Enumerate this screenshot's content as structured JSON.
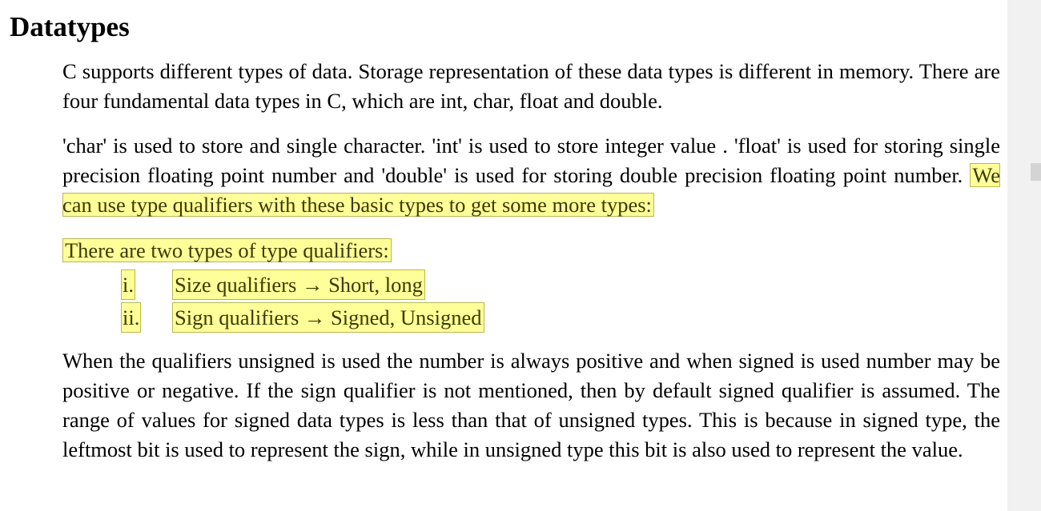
{
  "heading": "Datatypes",
  "para1": "C supports different types of data. Storage representation of these data types is different in memory. There are four fundamental data types in C, which are int, char, float and double.",
  "para2": {
    "text": "'char' is used to store and single character. 'int' is used to store integer value . 'float' is used for storing single precision floating point number and 'double' is used for storing double precision floating point number. ",
    "highlight": "We can use type qualifiers with these basic types to get some more types:"
  },
  "para3": "There are two types of type qualifiers:",
  "list": [
    {
      "marker": "i.",
      "text": "Size qualifiers → Short, long"
    },
    {
      "marker": "ii.",
      "text": "Sign qualifiers → Signed, Unsigned"
    }
  ],
  "para4": "When the qualifiers unsigned is used the number is always positive and when signed is used number may be positive or negative. If the sign qualifier is not mentioned, then by default signed qualifier is assumed. The range of values for signed data types is less than that of unsigned types. This is because in signed type, the leftmost bit is used to represent the sign, while in unsigned type this bit is also used to represent the value."
}
